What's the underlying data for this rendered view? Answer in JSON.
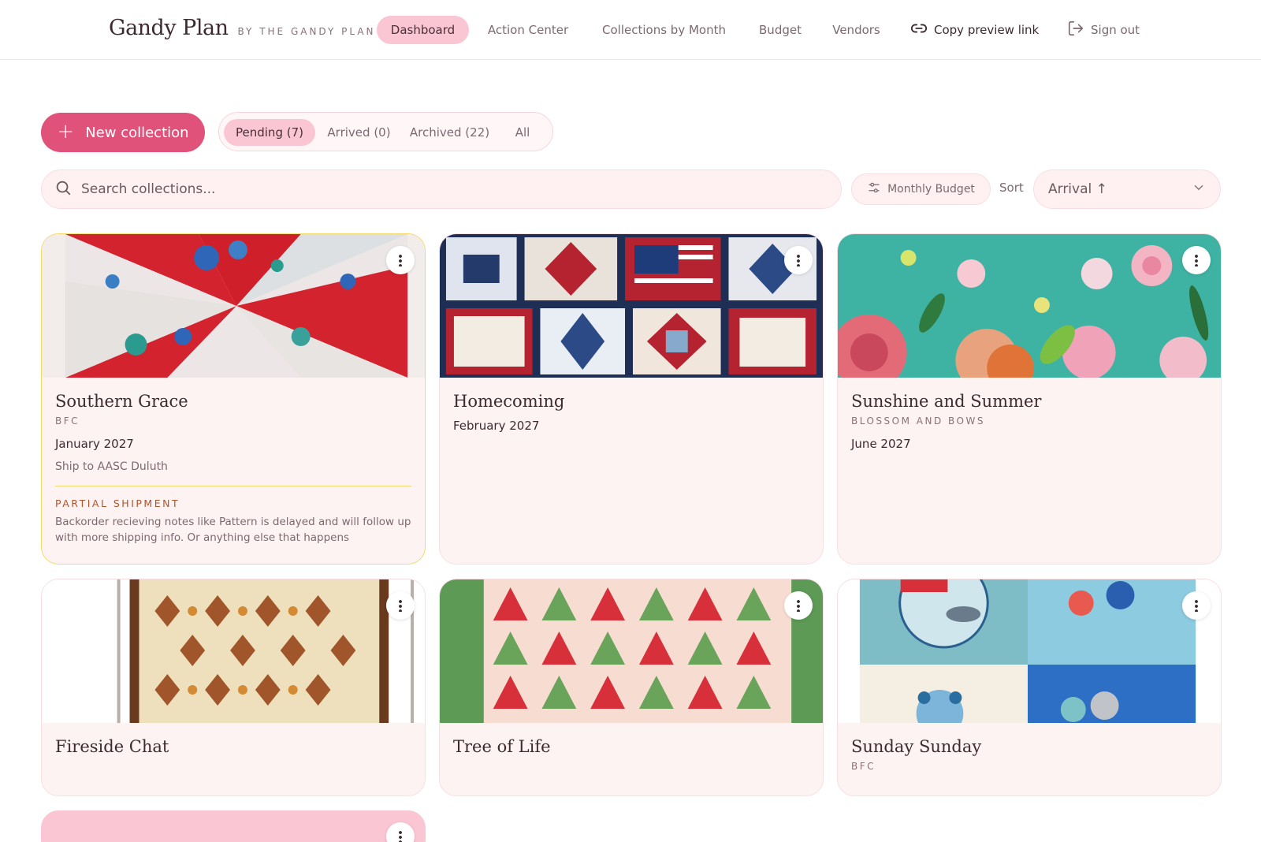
{
  "nav": {
    "brand": "Gandy Plan",
    "brand_by": "BY THE GANDY PLAN",
    "links": [
      "Dashboard",
      "Action Center",
      "Collections by Month",
      "Budget",
      "Vendors"
    ],
    "active": "Dashboard",
    "copy_link": "Copy preview link",
    "sign_out": "Sign out",
    "copy_icon": "link-icon",
    "sign_out_icon": "logout-icon"
  },
  "toolbar": {
    "new_collection": "New collection",
    "filters": [
      "Pending (7)",
      "Arrived (0)",
      "Archived (22)",
      "All"
    ],
    "active_filter": "Pending (7)",
    "search_placeholder": "Search collections...",
    "monthly_budget": "Monthly Budget",
    "sort_label": "Sort",
    "sort_value": "Arrival ↑"
  },
  "colors": {
    "accent": "#e0527a",
    "pill_active": "#fbc6d4",
    "card_bg": "#fef3f3",
    "highlight_border": "#f3d96b",
    "warning_text": "#b0542b"
  },
  "collections": [
    {
      "title": "Southern Grace",
      "subtitle": "BFC",
      "date": "January 2027",
      "ship": "Ship to AASC Duluth",
      "note_label": "PARTIAL SHIPMENT",
      "note": "Backorder recieving notes like Pattern is delayed and will follow up with more shipping info. Or anything else that happens"
    },
    {
      "title": "Homecoming",
      "subtitle": "",
      "date": "February 2027"
    },
    {
      "title": "Sunshine and Summer",
      "subtitle": "BLOSSOM AND BOWS",
      "date": "June 2027"
    },
    {
      "title": "Fireside Chat",
      "subtitle": "",
      "date": ""
    },
    {
      "title": "Tree of Life",
      "subtitle": "",
      "date": ""
    },
    {
      "title": "Sunday Sunday",
      "subtitle": "BFC",
      "date": ""
    }
  ]
}
